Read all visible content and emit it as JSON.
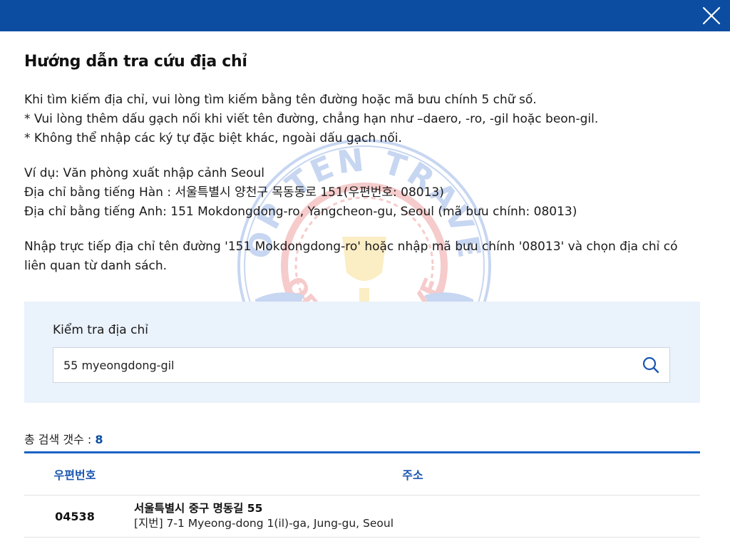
{
  "dialog": {
    "close_icon": "close-icon"
  },
  "title": "Hướng dẫn tra cứu địa chỉ",
  "guide": {
    "line1": "Khi tìm kiếm địa chỉ, vui lòng tìm kiếm bằng tên đường hoặc mã bưu chính 5 chữ số.",
    "line2": "* Vui lòng thêm dấu gạch nối khi viết tên đường, chẳng hạn như –daero, -ro, -gil hoặc beon-gil.",
    "line3": "* Không thể nhập các ký tự đặc biệt khác, ngoài dấu gạch nối.",
    "example_heading": "Ví dụ: Văn phòng xuất nhập cảnh Seoul",
    "example_korean": "Địa chỉ bằng tiếng Hàn : 서울특별시 양천구 목동동로 151(우편번호: 08013)",
    "example_english": "Địa chỉ bằng tiếng Anh: 151 Mokdongdong-ro, Yangcheon-gu, Seoul (mã bưu chính: 08013)",
    "instruction": "Nhập trực tiếp địa chỉ tên đường '151 Mokdongdong-ro' hoặc nhập mã bưu chính '08013' và chọn địa chỉ có liên quan từ danh sách."
  },
  "watermark": {
    "top_text": "TOP TEN TRAVEL",
    "bottom_text": "TOP 10 TRAVEL"
  },
  "search": {
    "label": "Kiểm tra địa chỉ",
    "value": "55 myeongdong-gil",
    "icon": "search-icon"
  },
  "results": {
    "count_label": "총 검색 갯수 :",
    "count": "8",
    "headers": {
      "zip": "우편번호",
      "address": "주소"
    },
    "rows": [
      {
        "zip": "04538",
        "road": "서울특별시 중구 명동길 55",
        "lot": "[지번] 7-1 Myeong-dong 1(il)-ga, Jung-gu, Seoul"
      }
    ]
  },
  "colors": {
    "header_bar": "#0c4da2",
    "accent": "#1a63c6",
    "panel": "#eaf2fb"
  }
}
